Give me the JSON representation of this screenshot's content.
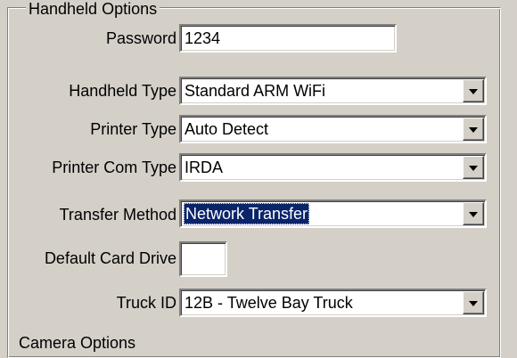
{
  "group": {
    "title": "Handheld Options",
    "next_group_title": "Camera Options"
  },
  "fields": {
    "password": {
      "label": "Password",
      "value": "1234"
    },
    "handheld_type": {
      "label": "Handheld Type",
      "value": "Standard ARM WiFi"
    },
    "printer_type": {
      "label": "Printer Type",
      "value": "Auto Detect"
    },
    "printer_com_type": {
      "label": "Printer Com Type",
      "value": "IRDA"
    },
    "transfer_method": {
      "label": "Transfer Method",
      "value": "Network Transfer"
    },
    "default_card_drive": {
      "label": "Default Card Drive",
      "value": ""
    },
    "truck_id": {
      "label": "Truck ID",
      "value": "12B - Twelve Bay Truck"
    }
  },
  "icons": {
    "dropdown": "chevron-down-icon"
  },
  "colors": {
    "selection": "#0a246a",
    "face": "#d4d0c8"
  }
}
